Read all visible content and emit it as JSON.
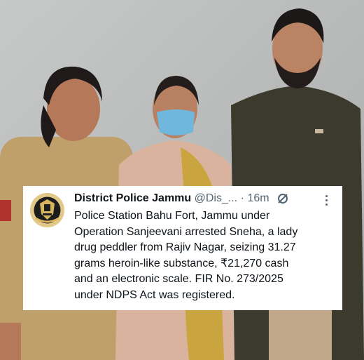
{
  "tweet": {
    "account_name": "District Police Jammu",
    "handle": "@Dis_...",
    "separator": "·",
    "time": "16m",
    "body": "Police Station Bahu Fort, Jammu  under\nOperation Sanjeevani arrested Sneha, a lady\ndrug peddler from Rajiv Nagar, seizing 31.27\ngrams heroin-like substance, ₹21,270 cash\nand an electronic scale. FIR No. 273/2025\nunder NDPS Act was registered."
  },
  "icons": {
    "avatar": "police-emblem-icon",
    "grok": "grok-icon",
    "more": "more-options-icon"
  },
  "colors": {
    "text": "#0f1419",
    "muted": "#536471",
    "card_background": "#ffffff"
  }
}
